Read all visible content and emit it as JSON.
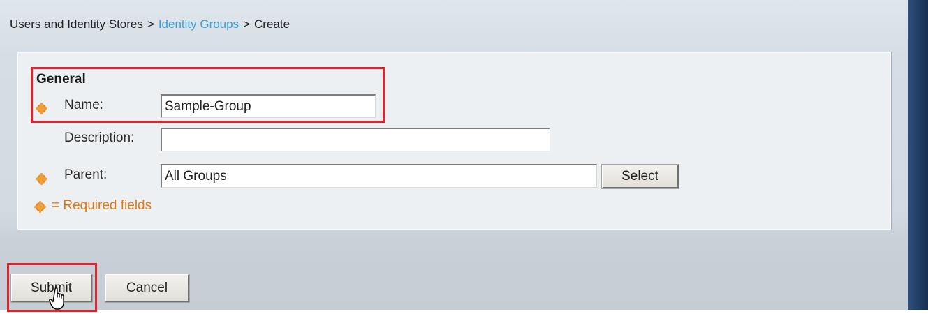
{
  "breadcrumb": {
    "root": "Users and Identity Stores",
    "separator": ">",
    "link": "Identity Groups",
    "current": "Create"
  },
  "form": {
    "section_title": "General",
    "name": {
      "label": "Name:",
      "value": "Sample-Group",
      "required": true
    },
    "description": {
      "label": "Description:",
      "value": "",
      "required": false
    },
    "parent": {
      "label": "Parent:",
      "value": "All Groups",
      "required": true,
      "select_label": "Select"
    },
    "required_note": "= Required fields"
  },
  "actions": {
    "submit_label": "Submit",
    "cancel_label": "Cancel"
  },
  "colors": {
    "link": "#3b9fd1",
    "required": "#e07a16",
    "highlight": "#e0242d"
  }
}
